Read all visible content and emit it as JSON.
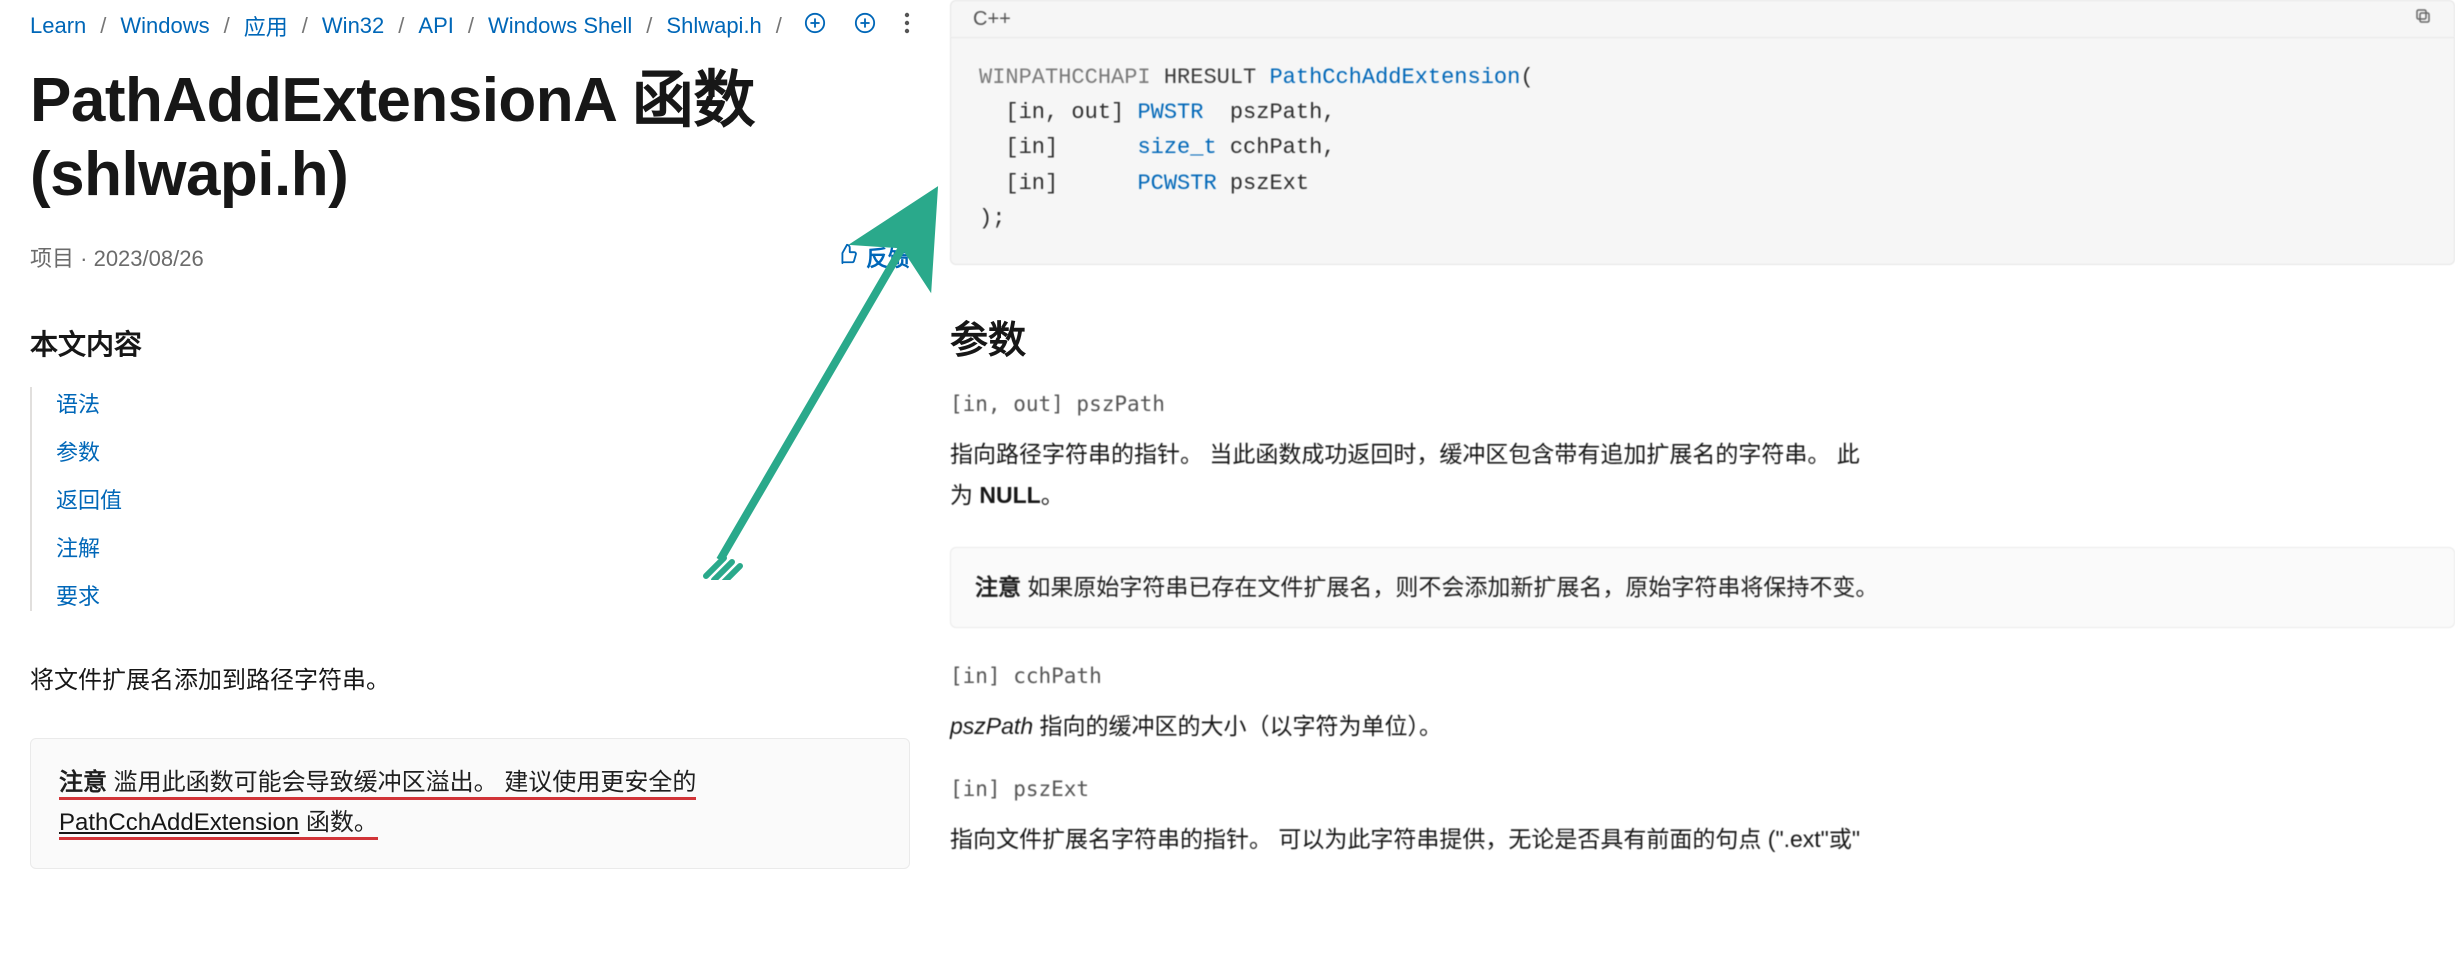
{
  "breadcrumb": {
    "items": [
      "Learn",
      "Windows",
      "应用",
      "Win32",
      "API",
      "Windows Shell",
      "Shlwapi.h"
    ]
  },
  "header_actions": {
    "add_icon_title": "添加",
    "save_icon_title": "保存",
    "more_icon_title": "更多"
  },
  "page": {
    "title": "PathAddExtensionA 函数 (shlwapi.h)",
    "meta_prefix": "项目",
    "meta_date": "2023/08/26",
    "feedback_label": "反馈"
  },
  "toc": {
    "heading": "本文内容",
    "items": [
      "语法",
      "参数",
      "返回值",
      "注解",
      "要求"
    ]
  },
  "intro_text": "将文件扩展名添加到路径字符串。",
  "note": {
    "label": "注意",
    "text_before_link": " 滥用此函数可能会导致缓冲区溢出。 建议使用更安全的 ",
    "link_text": "PathCchAddExtension",
    "text_after_link": " 函数。"
  },
  "code": {
    "lang": "C++",
    "macro": "WINPATHCCHAPI",
    "ret": "HRESULT",
    "func": "PathCchAddExtension",
    "open": "(",
    "p1_attr": "  [in, out]",
    "p1_type": "PWSTR",
    "p1_name": "pszPath,",
    "p2_attr": "  [in]     ",
    "p2_type": "size_t",
    "p2_name": "cchPath,",
    "p3_attr": "  [in]     ",
    "p3_type": "PCWSTR",
    "p3_name": "pszExt",
    "close": ");"
  },
  "right": {
    "heading": "参数",
    "param1_sig": "[in, out] pszPath",
    "param1_desc_a": "指向路径字符串的指针。 当此函数成功返回时，缓冲区包含带有追加扩展名的字符串。 此",
    "param1_desc_b": "为 ",
    "param1_desc_null": "NULL",
    "param1_desc_c": "。",
    "note2_label": "注意",
    "note2_text": " 如果原始字符串已存在文件扩展名，则不会添加新扩展名，原始字符串将保持不变。",
    "param2_sig": "[in] cchPath",
    "param2_italic": "pszPath",
    "param2_desc": " 指向的缓冲区的大小（以字符为单位）。",
    "param3_sig": "[in] pszExt",
    "param3_desc": "指向文件扩展名字符串的指针。 可以为此字符串提供，无论是否具有前面的句点 (\".ext\"或\""
  }
}
